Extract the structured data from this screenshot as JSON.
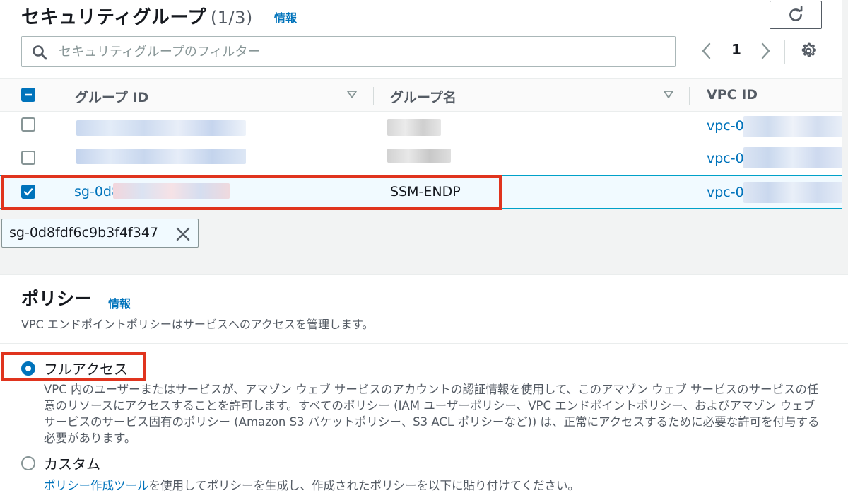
{
  "security_groups": {
    "title": "セキュリティグループ",
    "count": "(1/3)",
    "info_link": "情報",
    "search_placeholder": "セキュリティグループのフィルター",
    "pagination": {
      "prev": "‹",
      "current_page": "1",
      "next": "›"
    },
    "columns": [
      "グループ ID",
      "グループ名",
      "VPC ID"
    ],
    "rows": [
      {
        "checked": false,
        "group_id": "",
        "group_name": "",
        "vpc_id": "vpc-0"
      },
      {
        "checked": false,
        "group_id": "",
        "group_name": "",
        "vpc_id": "vpc-0"
      },
      {
        "checked": true,
        "group_id": "sg-0d8",
        "group_name": "SSM-ENDP",
        "vpc_id": "vpc-0"
      }
    ],
    "selected_token": "sg-0d8fdf6c9b3f4f347"
  },
  "policy": {
    "title": "ポリシー",
    "info_link": "情報",
    "description": "VPC エンドポイントポリシーはサービスへのアクセスを管理します。",
    "options": [
      {
        "label": "フルアクセス",
        "selected": true,
        "description": "VPC 内のユーザーまたはサービスが、アマゾン ウェブ サービスのアカウントの認証情報を使用して、このアマゾン ウェブ サービスのサービスの任意のリソースにアクセスすることを許可します。すべてのポリシー (IAM ユーザーポリシー、VPC エンドポイントポリシー、およびアマゾン ウェブ サービスのサービス固有のポリシー (Amazon S3 バケットポリシー、S3 ACL ポリシーなど)) は、正常にアクセスするために必要な許可を付与する必要があります。"
      },
      {
        "label": "カスタム",
        "selected": false,
        "description_link": "ポリシー作成ツール",
        "description_rest": "を使用してポリシーを生成し、作成されたポリシーを以下に貼り付けてください。"
      }
    ]
  },
  "colors": {
    "accent": "#0073bb",
    "highlight": "#e0341e",
    "text": "#16191f",
    "muted": "#545b64"
  },
  "icons": [
    "search-icon",
    "refresh-icon",
    "chevron-left-icon",
    "chevron-right-icon",
    "gear-icon",
    "sort-caret-icon",
    "close-icon"
  ]
}
